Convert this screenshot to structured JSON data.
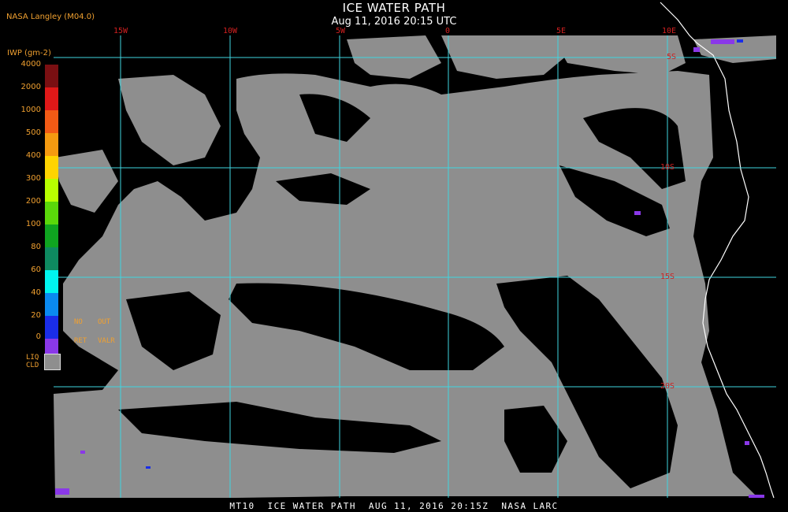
{
  "header": {
    "title": "ICE WATER PATH",
    "subtitle": "Aug 11, 2016 20:15 UTC",
    "org": "NASA Langley (M04.0)"
  },
  "legend": {
    "label": "IWP (gm-2)",
    "levels": [
      {
        "value": "4000",
        "color": "#7a0f12"
      },
      {
        "value": "2000",
        "color": "#e01818"
      },
      {
        "value": "1000",
        "color": "#f25a15"
      },
      {
        "value": "500",
        "color": "#f59a10"
      },
      {
        "value": "400",
        "color": "#ffd400"
      },
      {
        "value": "300",
        "color": "#b8ff00"
      },
      {
        "value": "200",
        "color": "#5ad80a"
      },
      {
        "value": "100",
        "color": "#0fa520"
      },
      {
        "value": "80",
        "color": "#0e8a60"
      },
      {
        "value": "60",
        "color": "#00f5f0"
      },
      {
        "value": "40",
        "color": "#0a8af0"
      },
      {
        "value": "20",
        "color": "#1a2de8"
      },
      {
        "value": "0",
        "color": "#8a38e8"
      }
    ],
    "no_ret": [
      "NO",
      "RET"
    ],
    "out_valr": [
      "OUT",
      "VALR"
    ],
    "liq_cld": [
      "LIQ",
      "CLD"
    ],
    "liq_color": "#8e8e8e"
  },
  "map": {
    "longitude_labels": [
      "15W",
      "10W",
      "5W",
      "0",
      "5E",
      "10E"
    ],
    "latitude_labels": [
      "5S",
      "10S",
      "15S",
      "20S"
    ],
    "grid_color": "#3fd6e0",
    "cloud_color": "#8e8e8e",
    "coast_color": "#ffffff"
  },
  "footer": "MT10  ICE WATER PATH  AUG 11, 2016 20:15Z  NASA LARC"
}
